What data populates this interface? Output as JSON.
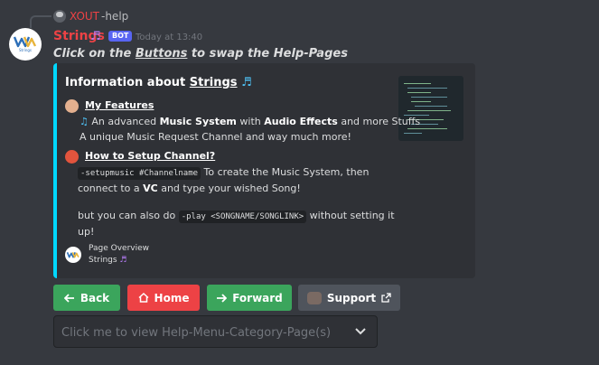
{
  "reply": {
    "username": "XOUT",
    "text": "-help"
  },
  "message": {
    "author": "Strings",
    "author_badge_icon": "music-note-icon",
    "bot_tag": "BOT",
    "timestamp": "Today at 13:40",
    "content_prefix": "Click on the ",
    "content_link": "Buttons",
    "content_suffix": " to swap the Help-Pages",
    "avatar_text": "Strings"
  },
  "embed": {
    "accent_color": "#00d8ff",
    "title_prefix": "Information about ",
    "title_link": "Strings",
    "fields": {
      "features": {
        "name": "My Features",
        "line1_pre": " An advanced ",
        "line1_b1": "Music System",
        "line1_mid": " with ",
        "line1_b2": "Audio Effects",
        "line1_post": " and more Stuffs",
        "line2": "A unique Music Request Channel and way much more!"
      },
      "setup": {
        "name": "How to Setup Channel?",
        "code1": "-setupmusic #Channelname",
        "line1_post": " To create the Music System, then",
        "line2_pre": "connect to a ",
        "line2_b": "VC",
        "line2_post": " and type your wished Song!",
        "line3_pre": "but you can also do ",
        "code2": "-play <SONGNAME/SONGLINK>",
        "line3_post": " without setting it",
        "line4": "up!"
      }
    },
    "footer": {
      "line1": "Page Overview",
      "line2": "Strings"
    }
  },
  "buttons": [
    {
      "label": "Back",
      "style": "success",
      "icon": "arrow-left-icon"
    },
    {
      "label": "Home",
      "style": "danger",
      "icon": "home-icon"
    },
    {
      "label": "Forward",
      "style": "success",
      "icon": "arrow-right-icon"
    },
    {
      "label": "Support",
      "style": "secondary",
      "icon": "external-link-icon"
    }
  ],
  "select_menu": {
    "placeholder": "Click me to view Help-Menu-Category-Page(s)"
  },
  "colors": {
    "background": "#36393f",
    "embed_bg": "#2f3136",
    "success": "#3ba55c",
    "danger": "#ed4245",
    "secondary": "#4f545c",
    "username": "#ed4245",
    "bot_tag": "#5865f2"
  }
}
